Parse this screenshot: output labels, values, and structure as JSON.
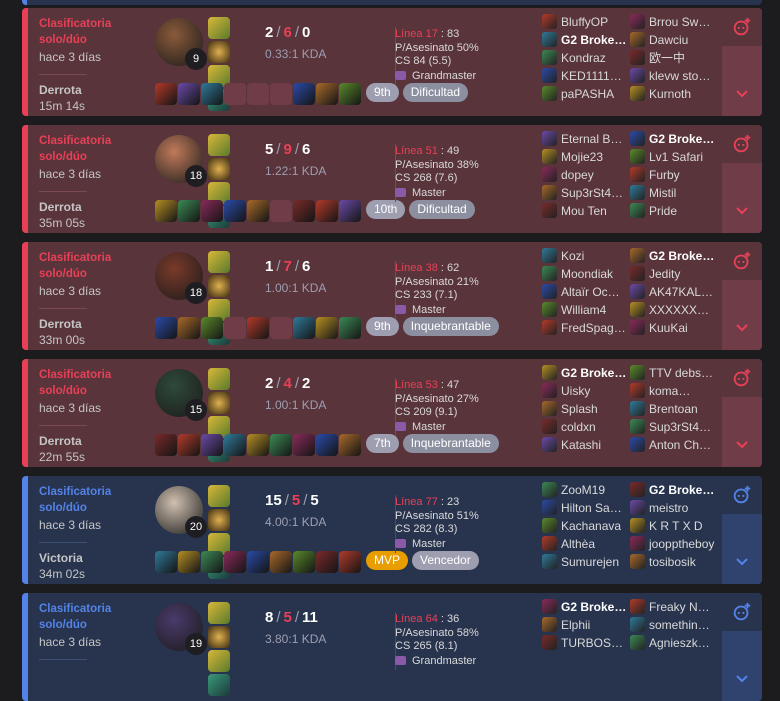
{
  "labels": {
    "kda_suffix": "KDA",
    "kill_participation": "P/Asesinato",
    "cs_prefix": "CS"
  },
  "matches": [
    {
      "outcome": "loss",
      "queue": "Clasificatoria solo/dúo",
      "ago": "hace 3 días",
      "result": "Derrota",
      "duration": "15m 14s",
      "champion_level": "9",
      "kills": "2",
      "deaths": "6",
      "assists": "0",
      "kda_ratio": "0.33:1 KDA",
      "placement": "9th",
      "badge": "Dificultad",
      "line_text": "Línea 17",
      "line_value": "83",
      "kp": "P/Asesinato 50%",
      "cs": "CS 84 (5.5)",
      "rank": "Grandmaster",
      "team_blue": [
        "BluffyOP",
        "G2 Broke…",
        "Kondraz",
        "KED1111…",
        "paPASHA"
      ],
      "team_red": [
        "Brrou Sw…",
        "Dawciu",
        "欧一中",
        "klevw sto…",
        "Kurnoth"
      ],
      "me_index_blue": 1,
      "me_index_red": -1,
      "items_filled": [
        true,
        true,
        true,
        false,
        false,
        false,
        true,
        true,
        true
      ]
    },
    {
      "outcome": "loss",
      "queue": "Clasificatoria solo/dúo",
      "ago": "hace 3 días",
      "result": "Derrota",
      "duration": "35m 05s",
      "champion_level": "18",
      "kills": "5",
      "deaths": "9",
      "assists": "6",
      "kda_ratio": "1.22:1 KDA",
      "placement": "10th",
      "badge": "Dificultad",
      "line_text": "Línea 51",
      "line_value": "49",
      "kp": "P/Asesinato 38%",
      "cs": "CS 268 (7.6)",
      "rank": "Master",
      "team_blue": [
        "Eternal B…",
        "Mojie23",
        "dopey",
        "Sup3rSt4…",
        "Mou Ten"
      ],
      "team_red": [
        "G2 Broke…",
        "Lv1 Safari",
        "Furby",
        "Mistil",
        "Pride"
      ],
      "me_index_blue": -1,
      "me_index_red": 0,
      "items_filled": [
        true,
        true,
        true,
        true,
        true,
        false,
        true,
        true,
        true
      ]
    },
    {
      "outcome": "loss",
      "queue": "Clasificatoria solo/dúo",
      "ago": "hace 3 días",
      "result": "Derrota",
      "duration": "33m 00s",
      "champion_level": "18",
      "kills": "1",
      "deaths": "7",
      "assists": "6",
      "kda_ratio": "1.00:1 KDA",
      "placement": "9th",
      "badge": "Inquebrantable",
      "line_text": "Línea 38",
      "line_value": "62",
      "kp": "P/Asesinato 21%",
      "cs": "CS 233 (7.1)",
      "rank": "Master",
      "team_blue": [
        "Kozi",
        "Moondiak",
        "Altaïr Oc…",
        "William4",
        "FredSpag…"
      ],
      "team_red": [
        "G2 Broke…",
        "Jedity",
        "AK47KAL…",
        "XXXXXX…",
        "KuuKai"
      ],
      "me_index_blue": -1,
      "me_index_red": 0,
      "items_filled": [
        true,
        true,
        true,
        false,
        true,
        false,
        true,
        true,
        true
      ]
    },
    {
      "outcome": "loss",
      "queue": "Clasificatoria solo/dúo",
      "ago": "hace 3 días",
      "result": "Derrota",
      "duration": "22m 55s",
      "champion_level": "15",
      "kills": "2",
      "deaths": "4",
      "assists": "2",
      "kda_ratio": "1.00:1 KDA",
      "placement": "7th",
      "badge": "Inquebrantable",
      "line_text": "Línea 53",
      "line_value": "47",
      "kp": "P/Asesinato 27%",
      "cs": "CS 209 (9.1)",
      "rank": "Master",
      "team_blue": [
        "G2 Broke…",
        "Uisky",
        "Splash",
        "coldxn",
        "Katashi"
      ],
      "team_red": [
        "TTV debs…",
        "koma…",
        "Brentoan",
        "Sup3rSt4…",
        "Anton Ch…"
      ],
      "me_index_blue": 0,
      "me_index_red": -1,
      "items_filled": [
        true,
        true,
        true,
        true,
        true,
        true,
        true,
        true,
        true
      ]
    },
    {
      "outcome": "win",
      "queue": "Clasificatoria solo/dúo",
      "ago": "hace 3 días",
      "result": "Victoria",
      "duration": "34m 02s",
      "champion_level": "20",
      "kills": "15",
      "deaths": "5",
      "assists": "5",
      "kda_ratio": "4.00:1 KDA",
      "placement": "MVP",
      "badge": "Vencedor",
      "line_text": "Línea 77",
      "line_value": "23",
      "kp": "P/Asesinato 51%",
      "cs": "CS 282 (8.3)",
      "rank": "Master",
      "team_blue": [
        "ZooM19",
        "Hilton Sa…",
        "Kachanava",
        "Althèa",
        "Sumurejen"
      ],
      "team_red": [
        "G2 Broke…",
        "meistro",
        "K R T X D",
        "joopptheboy",
        "tosibosik"
      ],
      "me_index_blue": -1,
      "me_index_red": 0,
      "items_filled": [
        true,
        true,
        true,
        true,
        true,
        true,
        true,
        true,
        true
      ]
    },
    {
      "outcome": "win",
      "queue": "Clasificatoria solo/dúo",
      "ago": "hace 3 días",
      "result": "",
      "duration": "",
      "champion_level": "19",
      "kills": "8",
      "deaths": "5",
      "assists": "11",
      "kda_ratio": "3.80:1 KDA",
      "placement": "",
      "badge": "",
      "line_text": "Línea 64",
      "line_value": "36",
      "kp": "P/Asesinato 58%",
      "cs": "CS 265 (8.1)",
      "rank": "Grandmaster",
      "team_blue": [
        "G2 Broke…",
        "Elphii",
        "TURBOS…"
      ],
      "team_red": [
        "Freaky N…",
        "somethin…",
        "Agnieszk…"
      ],
      "me_index_blue": 0,
      "me_index_red": -1,
      "items_filled": []
    }
  ],
  "colors": {
    "loss_bg": "#59343b",
    "win_bg": "#28344e",
    "loss_accent": "#e84057",
    "win_accent": "#5383e8",
    "mvp": "#e89d00"
  },
  "icons": {
    "expand": "chevron-down-icon",
    "options": "add-spectate-icon"
  }
}
